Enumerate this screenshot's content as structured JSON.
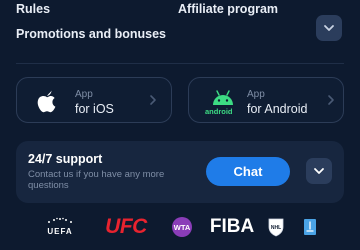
{
  "footer_links": {
    "rules": "Rules",
    "affiliate": "Affiliate program",
    "promotions": "Promotions and bonuses"
  },
  "apps": {
    "ios": {
      "small": "App",
      "big": "for iOS",
      "icon": "apple-icon"
    },
    "android": {
      "small": "App",
      "big": "for Android",
      "icon": "android-icon",
      "logo_text": "android"
    }
  },
  "support": {
    "title": "24/7 support",
    "description": "Contact us if you have any more questions",
    "chat_label": "Chat"
  },
  "partners": {
    "uefa": "UEFA",
    "ufc": "UFC",
    "wta": "WTA",
    "fiba": "FIBA",
    "nhl": "NHL"
  },
  "colors": {
    "background": "#0d1a2f",
    "card": "#17263f",
    "accent": "#1f7ce8",
    "ufc_red": "#e8232f",
    "wta_purple": "#8a3db8",
    "android_green": "#3ddc84"
  }
}
